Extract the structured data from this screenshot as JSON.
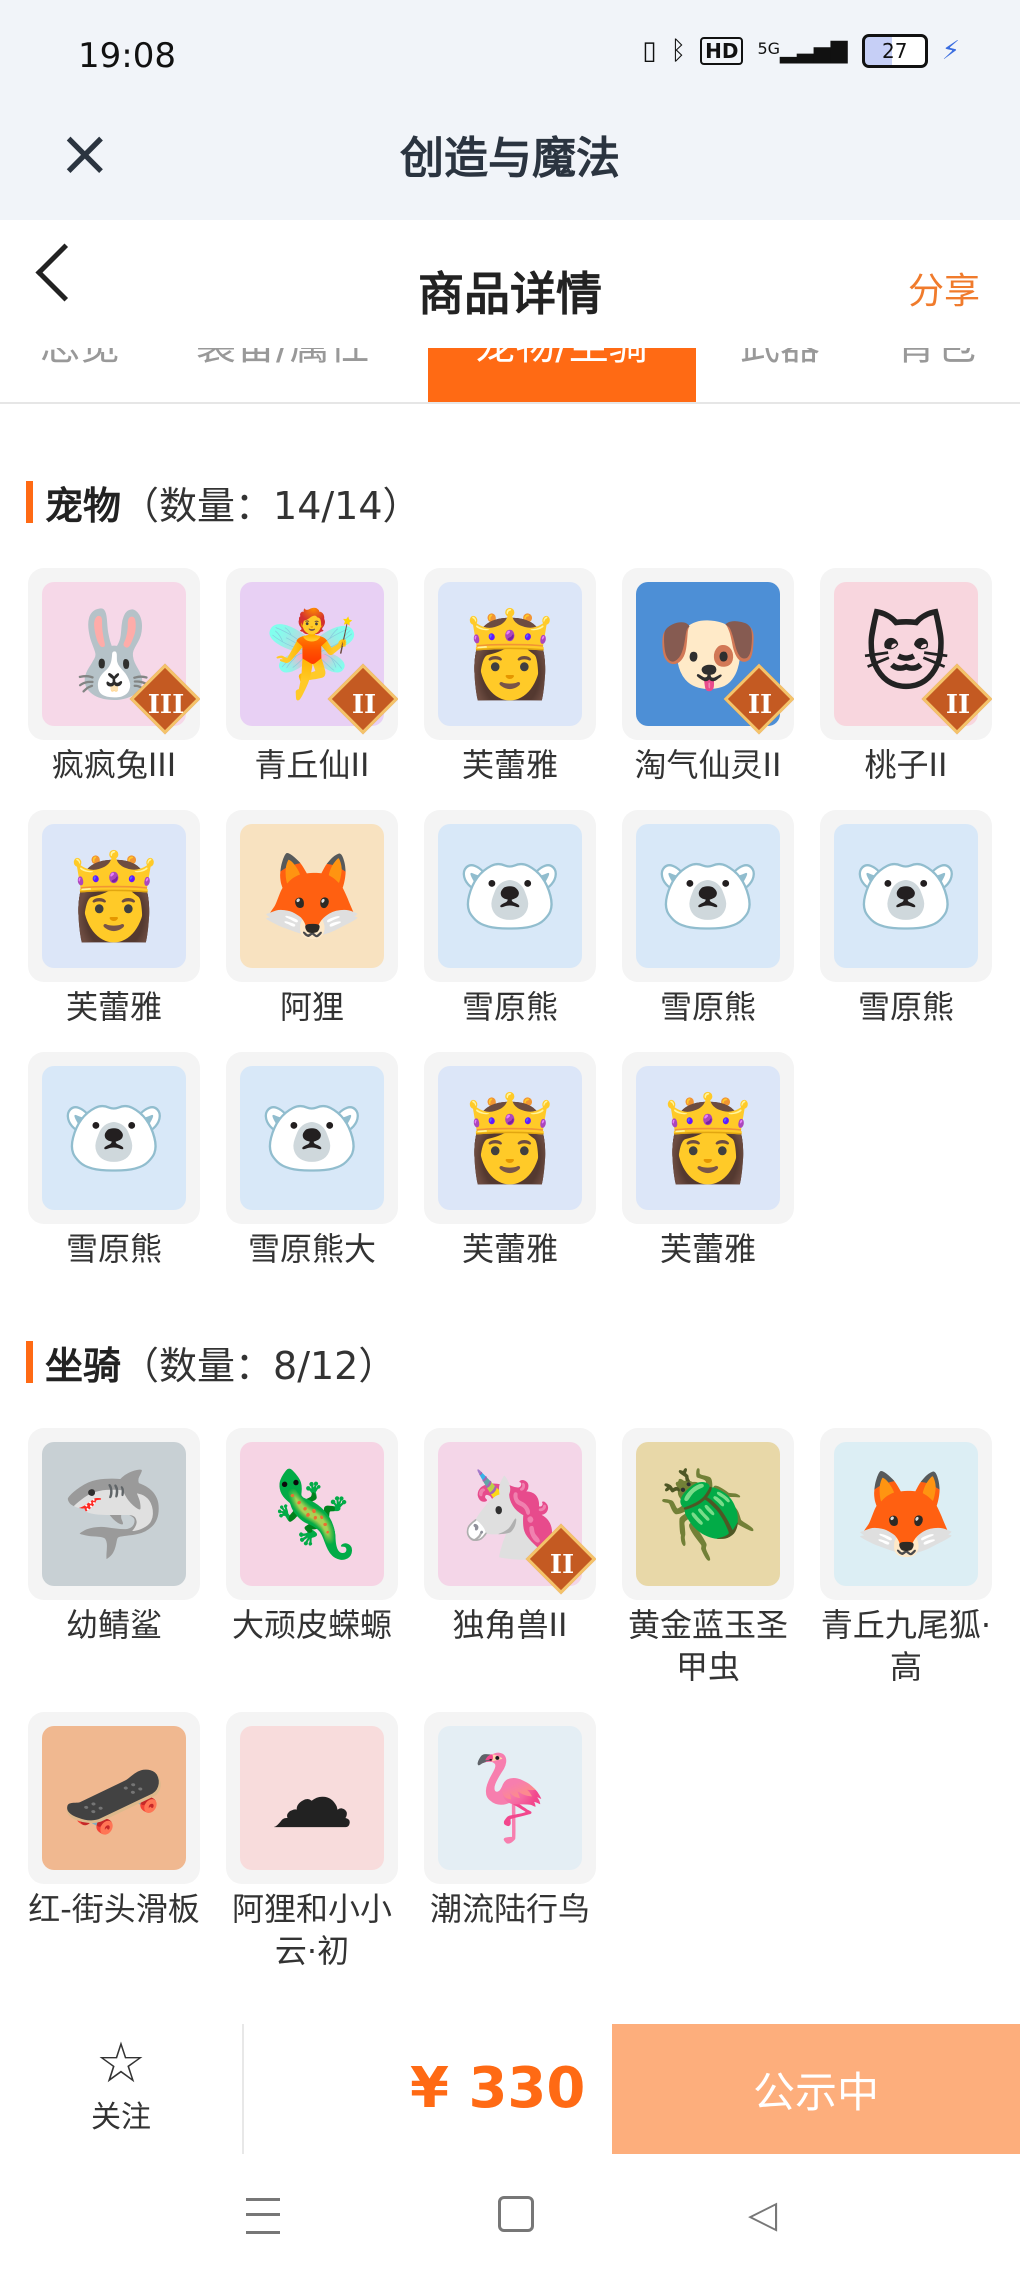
{
  "status_bar": {
    "time": "19:08",
    "network": "5G",
    "hd": "HD",
    "battery": "27"
  },
  "app_bar": {
    "title": "创造与魔法"
  },
  "nav": {
    "title": "商品详情",
    "share": "分享"
  },
  "tabs": [
    "总览",
    "装备/属性",
    "宠物/坐骑",
    "武器",
    "背包"
  ],
  "pets": {
    "title": "宠物",
    "count": "（数量：14/14）",
    "items": [
      {
        "name": "疯疯兔III",
        "badge": "III",
        "color": "#f6d8e8",
        "icon": "rabbit-icon"
      },
      {
        "name": "青丘仙II",
        "badge": "II",
        "color": "#e8d0f4",
        "icon": "fox-fairy-icon"
      },
      {
        "name": "芙蕾雅",
        "badge": "",
        "color": "#dce6f8",
        "icon": "freya-icon"
      },
      {
        "name": "淘气仙灵II",
        "badge": "II",
        "color": "#4d8fd6",
        "icon": "blue-dog-icon"
      },
      {
        "name": "桃子II",
        "badge": "II",
        "color": "#f8d6de",
        "icon": "peach-cat-icon"
      },
      {
        "name": "芙蕾雅",
        "badge": "",
        "color": "#dce6f8",
        "icon": "freya-icon"
      },
      {
        "name": "阿狸",
        "badge": "",
        "color": "#f8e2c0",
        "icon": "ali-icon"
      },
      {
        "name": "雪原熊",
        "badge": "",
        "color": "#d8e8f8",
        "icon": "snow-bear-icon"
      },
      {
        "name": "雪原熊",
        "badge": "",
        "color": "#d8e8f8",
        "icon": "snow-bear-icon"
      },
      {
        "name": "雪原熊",
        "badge": "",
        "color": "#d8e8f8",
        "icon": "snow-bear-icon"
      },
      {
        "name": "雪原熊",
        "badge": "",
        "color": "#d8e8f8",
        "icon": "snow-bear-icon"
      },
      {
        "name": "雪原熊大",
        "badge": "",
        "color": "#d8e8f8",
        "icon": "snow-bear-icon"
      },
      {
        "name": "芙蕾雅",
        "badge": "",
        "color": "#dce6f8",
        "icon": "freya-icon"
      },
      {
        "name": "芙蕾雅",
        "badge": "",
        "color": "#dce6f8",
        "icon": "freya-icon"
      }
    ]
  },
  "mounts": {
    "title": "坐骑",
    "count": "（数量：8/12）",
    "items": [
      {
        "name": "幼鲭鲨",
        "badge": "",
        "color": "#c8d0d4",
        "icon": "shark-icon"
      },
      {
        "name": "大顽皮蝾螈",
        "badge": "",
        "color": "#f6d4e4",
        "icon": "axolotl-icon"
      },
      {
        "name": "独角兽II",
        "badge": "II",
        "color": "#f4d6e8",
        "icon": "unicorn-icon"
      },
      {
        "name": "黄金蓝玉圣甲虫",
        "badge": "",
        "color": "#e8d8a8",
        "icon": "beetle-icon"
      },
      {
        "name": "青丘九尾狐·高",
        "badge": "",
        "color": "#dceef4",
        "icon": "nine-tail-fox-icon"
      },
      {
        "name": "红-街头滑板",
        "badge": "",
        "color": "#f0b890",
        "icon": "skateboard-icon"
      },
      {
        "name": "阿狸和小小云·初",
        "badge": "",
        "color": "#f8dcdc",
        "icon": "ali-cloud-icon"
      },
      {
        "name": "潮流陆行鸟",
        "badge": "",
        "color": "#e4eef4",
        "icon": "bird-icon"
      }
    ]
  },
  "bottom": {
    "follow_label": "关注",
    "price": "¥ 330",
    "status_label": "公示中"
  }
}
